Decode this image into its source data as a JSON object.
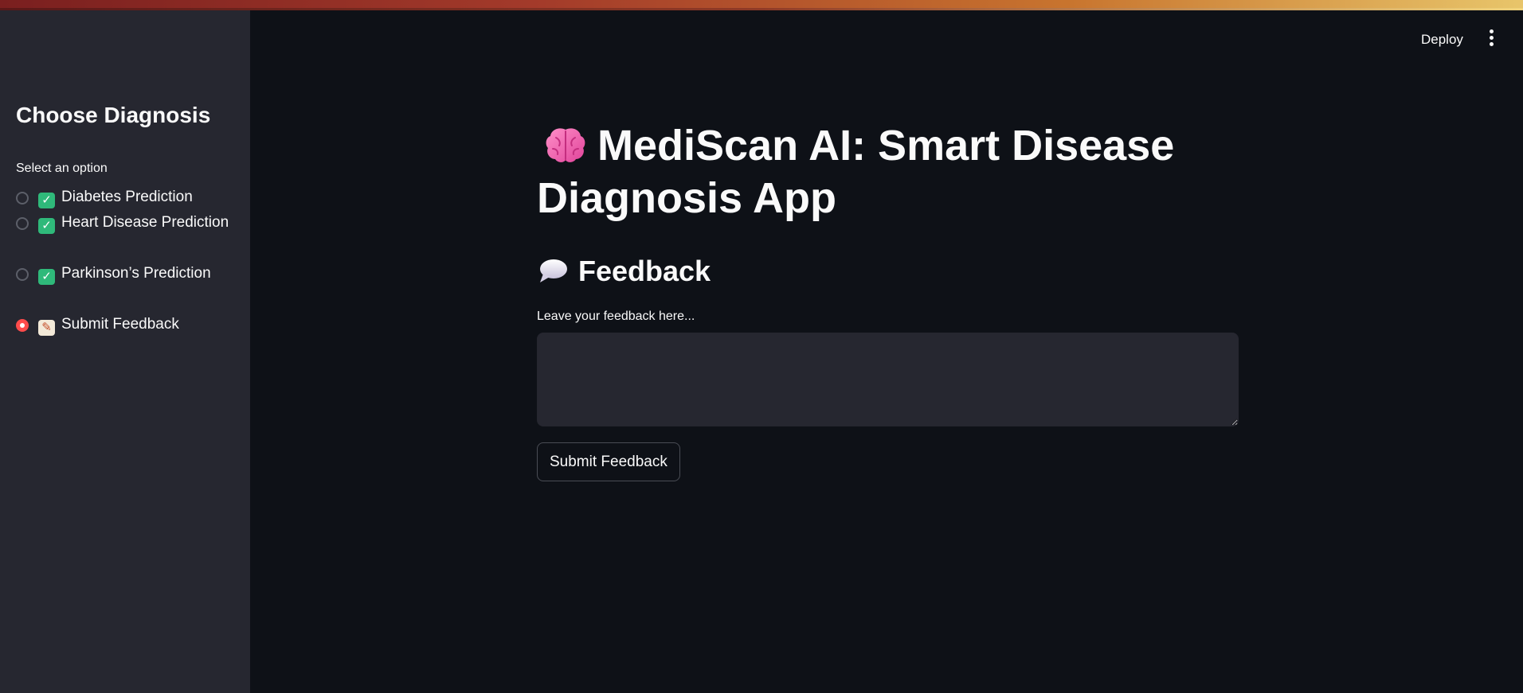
{
  "header": {
    "deploy_label": "Deploy",
    "menu_icon": "kebab-menu-icon"
  },
  "sidebar": {
    "title": "Choose Diagnosis",
    "select_label": "Select an option",
    "options": [
      {
        "icon": "check-mark-icon",
        "label": "Diabetes Prediction",
        "selected": false
      },
      {
        "icon": "check-mark-icon",
        "label": "Heart Disease Prediction",
        "selected": false
      },
      {
        "icon": "check-mark-icon",
        "label": "Parkinson’s Prediction",
        "selected": false
      },
      {
        "icon": "memo-icon",
        "label": "Submit Feedback",
        "selected": true
      }
    ]
  },
  "main": {
    "title_icon": "brain-icon",
    "title": "MediScan AI: Smart Disease Diagnosis App",
    "section_icon": "speech-bubble-icon",
    "section_heading": "Feedback",
    "textarea_label": "Leave your feedback here...",
    "textarea_value": "",
    "submit_label": "Submit Feedback"
  },
  "colors": {
    "background": "#0e1117",
    "sidebar": "#262730",
    "accent": "#ff4b4b",
    "check_green": "#2fb97a",
    "text": "#fafafa"
  }
}
